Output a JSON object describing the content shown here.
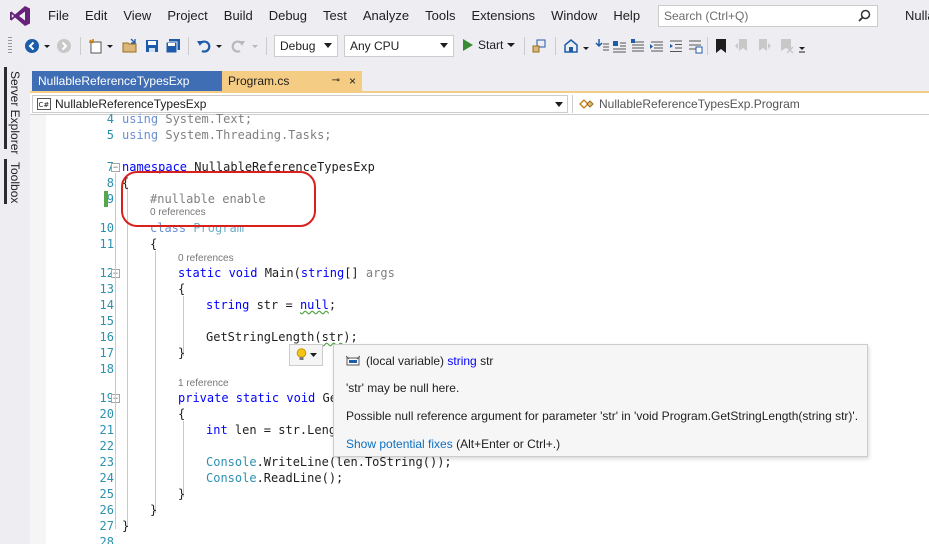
{
  "menu": [
    "File",
    "Edit",
    "View",
    "Project",
    "Build",
    "Debug",
    "Test",
    "Analyze",
    "Tools",
    "Extensions",
    "Window",
    "Help"
  ],
  "search": {
    "placeholder": "Search (Ctrl+Q)"
  },
  "window_title": "Nulla",
  "toolbar": {
    "configuration": "Debug",
    "platform": "Any CPU",
    "start_label": "Start"
  },
  "side_tabs": [
    "Server Explorer",
    "Toolbox"
  ],
  "tabs": [
    {
      "label": "NullableReferenceTypesExp",
      "active": false
    },
    {
      "label": "Program.cs",
      "active": true,
      "pin": "⊸",
      "close": "×"
    }
  ],
  "navbar": {
    "project": "NullableReferenceTypesExp",
    "scope": "NullableReferenceTypesExp.Program"
  },
  "editor": {
    "line_numbers": [
      "4",
      "5",
      "7",
      "8",
      "9",
      "10",
      "11",
      "12",
      "13",
      "14",
      "15",
      "16",
      "17",
      "18",
      "19",
      "20",
      "21",
      "22",
      "23",
      "24",
      "25",
      "26",
      "27",
      "28"
    ],
    "codelens": [
      "0 references",
      "0 references",
      "1 reference"
    ],
    "code": {
      "l4a": "using ",
      "l4b": "System.Text;",
      "l5a": "using ",
      "l5b": "System.Threading.Tasks;",
      "l7a": "namespace",
      "l7b": " NullableReferenceTypesExp",
      "l8": "{",
      "l9": "#nullable enable",
      "l10a": "class",
      "l10b": " Program",
      "l11": "{",
      "l12a": "static",
      "l12b": " void",
      "l12c": " Main(",
      "l12d": "string",
      "l12e": "[] ",
      "l12f": "args",
      "l13": "{",
      "l14a": "string",
      "l14b": " str = ",
      "l14c": "null",
      "l14d": ";",
      "l16a": "GetStringLength(",
      "l16b": "str",
      "l16c": ");",
      "l17": "}",
      "l19a": "private",
      "l19b": " static",
      "l19c": " void",
      "l19d": " Ge",
      "l20": "{",
      "l21a": "int",
      "l21b": " len = str.Leng",
      "l23a": "Console",
      "l23b": ".WriteLine(len.ToString());",
      "l24a": "Console",
      "l24b": ".ReadLine();",
      "l25": "}",
      "l26": "}",
      "l27": "}"
    }
  },
  "quickinfo": {
    "kind": "(local variable)",
    "type": "string",
    "name": "str",
    "warning": "'str' may be null here.",
    "message": "Possible null reference argument for parameter 'str' in 'void Program.GetStringLength(string str)'.",
    "link": "Show potential fixes",
    "shortcut": "(Alt+Enter or Ctrl+.)"
  },
  "colors": {
    "accent": "#68217a",
    "keyword": "#0000ff",
    "type": "#2b91af",
    "active_tab": "#f5cc84",
    "annotation": "#d9201c"
  }
}
